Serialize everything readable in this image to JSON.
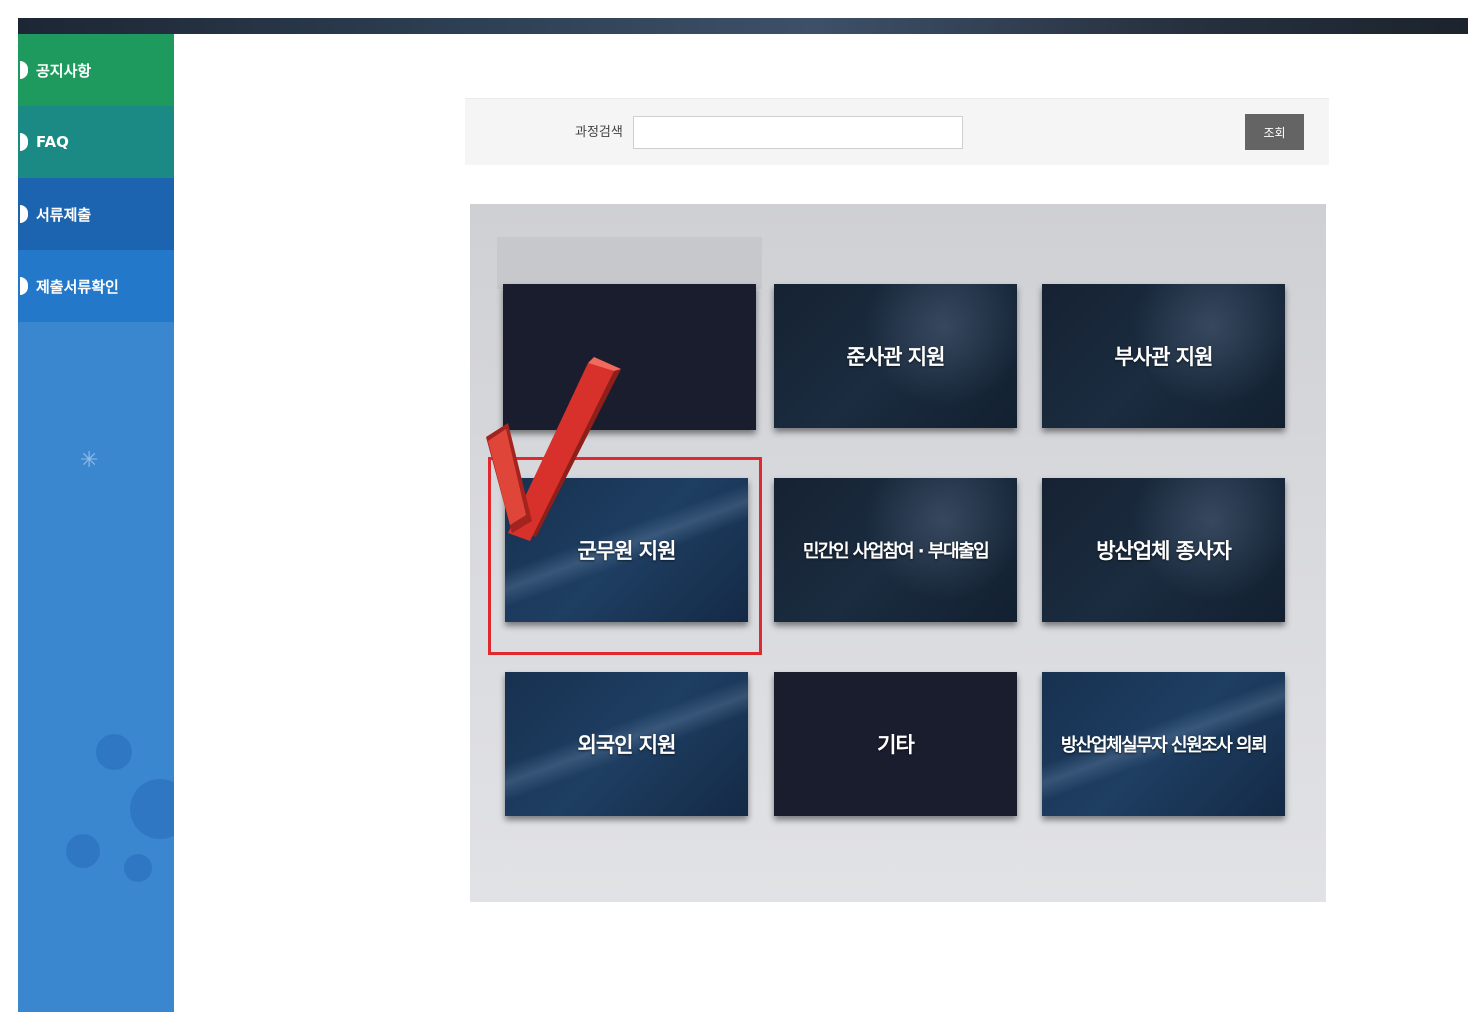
{
  "sidebar": {
    "items": [
      {
        "label": "공지사항"
      },
      {
        "label": "FAQ"
      },
      {
        "label": "서류제출"
      },
      {
        "label": "제출서류확인"
      }
    ]
  },
  "search": {
    "label": "과정검색",
    "value": "",
    "placeholder": "",
    "button_label": "조회"
  },
  "categories": [
    {
      "label": ""
    },
    {
      "label": "준사관 지원"
    },
    {
      "label": "부사관 지원"
    },
    {
      "label": "군무원 지원"
    },
    {
      "label": "민간인 사업참여 · 부대출입"
    },
    {
      "label": "방산업체 종사자"
    },
    {
      "label": "외국인 지원"
    },
    {
      "label": "기타"
    },
    {
      "label": "방산업체실무자 신원조사 의뢰"
    }
  ],
  "selected_category": "군무원 지원",
  "colors": {
    "highlight": "#e0282f",
    "checkmark": "#d8302a",
    "sidebar": "#3a86cf",
    "card_dark": "#152232"
  }
}
